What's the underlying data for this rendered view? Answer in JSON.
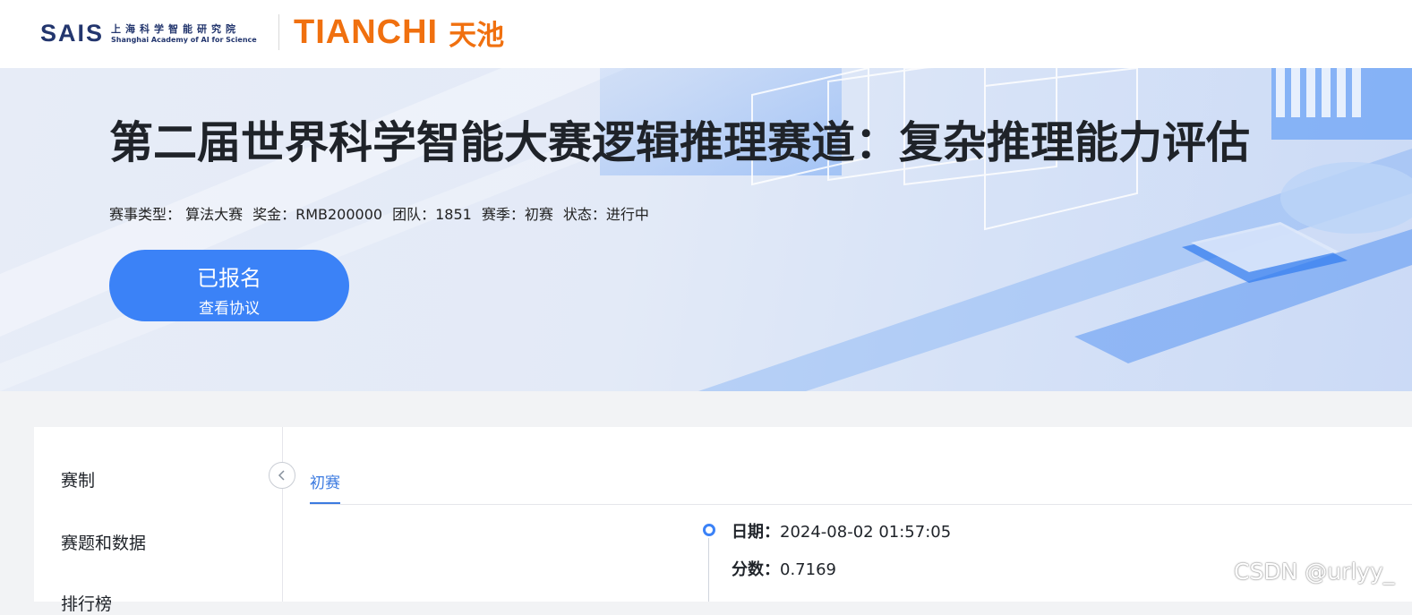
{
  "header": {
    "sais_word": "SAIS",
    "sais_cn": "上海科学智能研究院",
    "sais_en": "Shanghai Academy of AI for Science",
    "tianchi_en": "TIANCHI",
    "tianchi_cn": "天池"
  },
  "banner": {
    "title": "第二届世界科学智能大赛逻辑推理赛道：复杂推理能力评估",
    "meta": {
      "type": "赛事类型：  算法大赛",
      "prize": "奖金：RMB200000",
      "team": "团队：1851",
      "season": "赛季：初赛",
      "status": "状态：进行中"
    },
    "signup": {
      "label": "已报名",
      "sub_label": "查看协议"
    }
  },
  "sidebar": {
    "items": [
      {
        "label": "赛制"
      },
      {
        "label": "赛题和数据"
      },
      {
        "label": "排行榜"
      }
    ]
  },
  "tabs": [
    {
      "label": "初赛",
      "active": true
    }
  ],
  "record": {
    "date_label": "日期：",
    "date_value": "2024-08-02 01:57:05",
    "score_label": "分数：",
    "score_value": "0.7169"
  },
  "watermark": "CSDN @urlyy_",
  "colors": {
    "accent": "#3b82f7",
    "brand_orange": "#f0700f",
    "sais_navy": "#23366e"
  }
}
